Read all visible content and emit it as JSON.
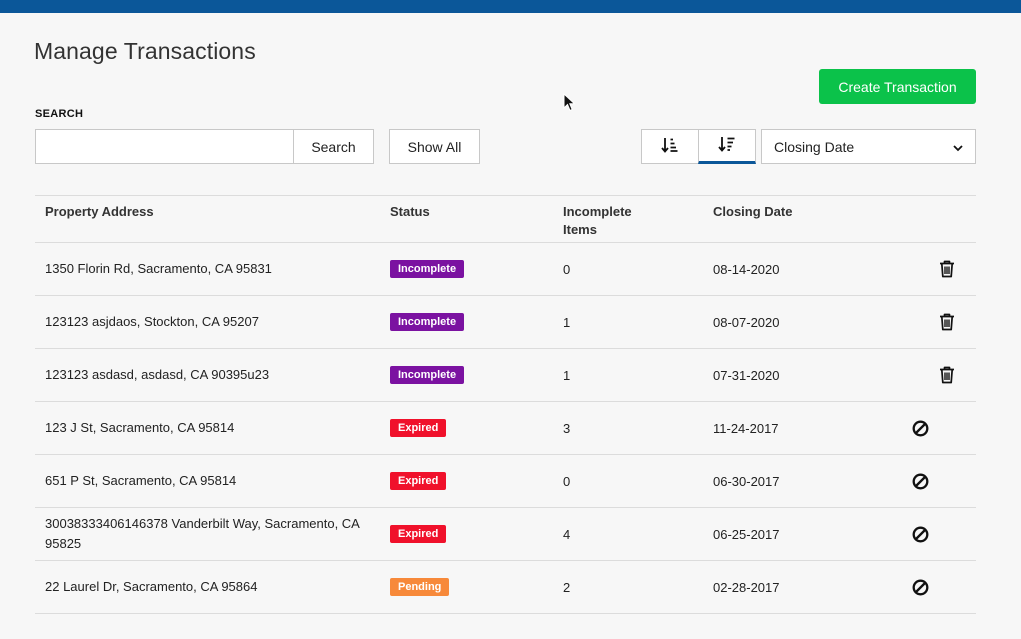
{
  "header": {
    "title": "Manage Transactions",
    "create_label": "Create Transaction"
  },
  "search": {
    "label": "SEARCH",
    "value": "",
    "placeholder": "",
    "button_label": "Search",
    "show_all_label": "Show All"
  },
  "sort": {
    "selected": "Closing Date",
    "active_direction": "descending"
  },
  "table": {
    "columns": [
      "Property Address",
      "Status",
      "Incomplete Items",
      "Closing Date"
    ],
    "rows": [
      {
        "address": "1350 Florin Rd, Sacramento, CA 95831",
        "status": "Incomplete",
        "items": "0",
        "date": "08-14-2020",
        "action": "trash-icon"
      },
      {
        "address": "123123 asjdaos, Stockton, CA 95207",
        "status": "Incomplete",
        "items": "1",
        "date": "08-07-2020",
        "action": "trash-icon"
      },
      {
        "address": "123123 asdasd, asdasd, CA 90395u23",
        "status": "Incomplete",
        "items": "1",
        "date": "07-31-2020",
        "action": "trash-icon"
      },
      {
        "address": "123 J St, Sacramento, CA 95814",
        "status": "Expired",
        "items": "3",
        "date": "11-24-2017",
        "action": "block-icon"
      },
      {
        "address": "651 P St, Sacramento, CA 95814",
        "status": "Expired",
        "items": "0",
        "date": "06-30-2017",
        "action": "block-icon"
      },
      {
        "address": "30038333406146378 Vanderbilt Way, Sacramento, CA 95825",
        "status": "Expired",
        "items": "4",
        "date": "06-25-2017",
        "action": "block-icon"
      },
      {
        "address": "22 Laurel Dr, Sacramento, CA 95864",
        "status": "Pending",
        "items": "2",
        "date": "02-28-2017",
        "action": "block-icon"
      }
    ]
  },
  "status_colors": {
    "Incomplete": "#7b12a1",
    "Expired": "#f0112b",
    "Pending": "#f7893a"
  },
  "colors": {
    "topbar": "#0b5799",
    "primary_button": "#0bc24a"
  }
}
